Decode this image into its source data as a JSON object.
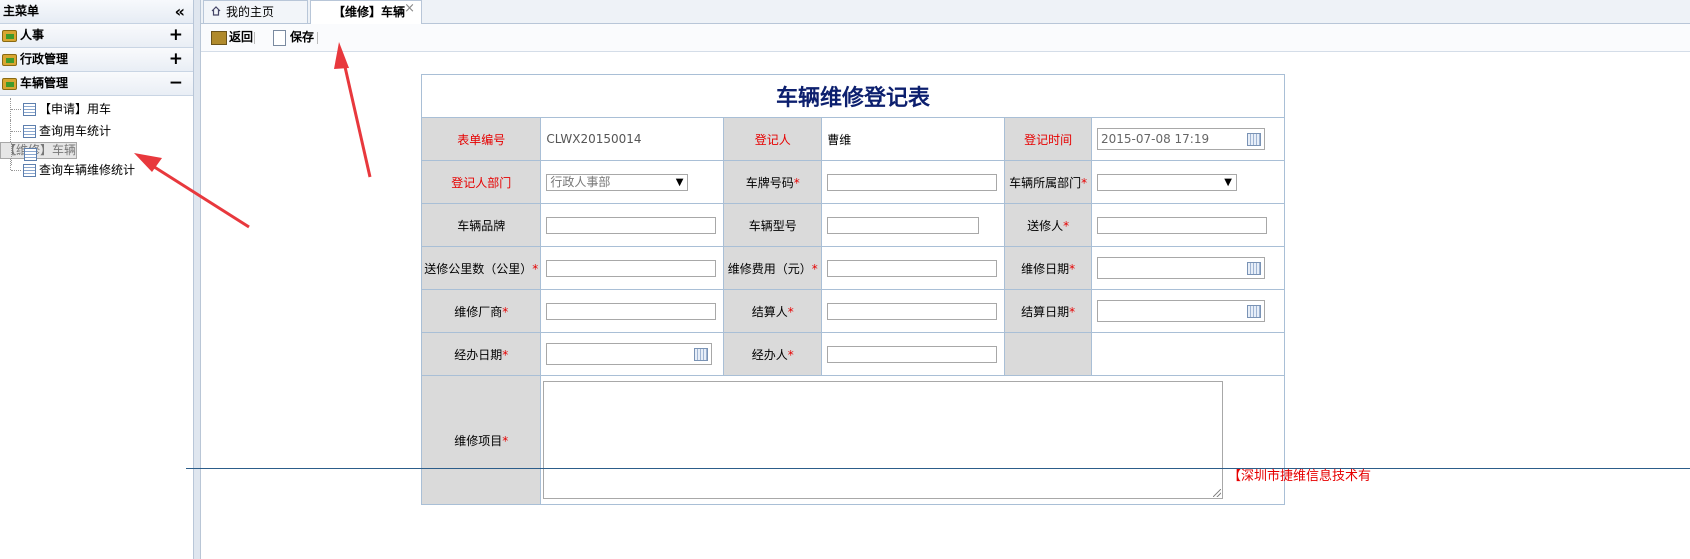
{
  "sidebar": {
    "title": "主菜单",
    "collapse_glyph": "«",
    "groups": [
      {
        "label": "人事",
        "toggle": "+"
      },
      {
        "label": "行政管理",
        "toggle": "+"
      },
      {
        "label": "车辆管理",
        "toggle": "−"
      }
    ],
    "items": [
      {
        "label": "【申请】用车"
      },
      {
        "label": "查询用车统计"
      },
      {
        "label": "【维修】车辆",
        "selected": true
      },
      {
        "label": "查询车辆维修统计"
      }
    ]
  },
  "tabs": {
    "home_label": "我的主页",
    "active_label": "【维修】车辆",
    "close_glyph": "×"
  },
  "toolbar": {
    "back_label": "返回",
    "save_label": "保存"
  },
  "form": {
    "title": "车辆维修登记表",
    "labels": {
      "form_no": "表单编号",
      "registrant": "登记人",
      "reg_time": "登记时间",
      "registrant_dept": "登记人部门",
      "plate_no": "车牌号码",
      "vehicle_dept": "车辆所属部门",
      "brand": "车辆品牌",
      "model": "车辆型号",
      "sender": "送修人",
      "mileage": "送修公里数（公里）",
      "cost": "维修费用（元）",
      "repair_date": "维修日期",
      "repair_vendor": "维修厂商",
      "settler": "结算人",
      "settle_date": "结算日期",
      "handle_date": "经办日期",
      "handler": "经办人",
      "repair_items": "维修项目"
    },
    "required_mark": "*",
    "values": {
      "form_no": "CLWX20150014",
      "registrant": "曹维",
      "reg_time": "2015-07-08 17:19",
      "registrant_dept": "行政人事部",
      "select_arrow": "▼"
    }
  },
  "footer": {
    "company": "【深圳市捷维信息技术有"
  },
  "colors": {
    "required": "#e60000",
    "title": "#0c1f6e",
    "label_bg": "#dadada",
    "annotation_arrow": "#e8383d"
  }
}
